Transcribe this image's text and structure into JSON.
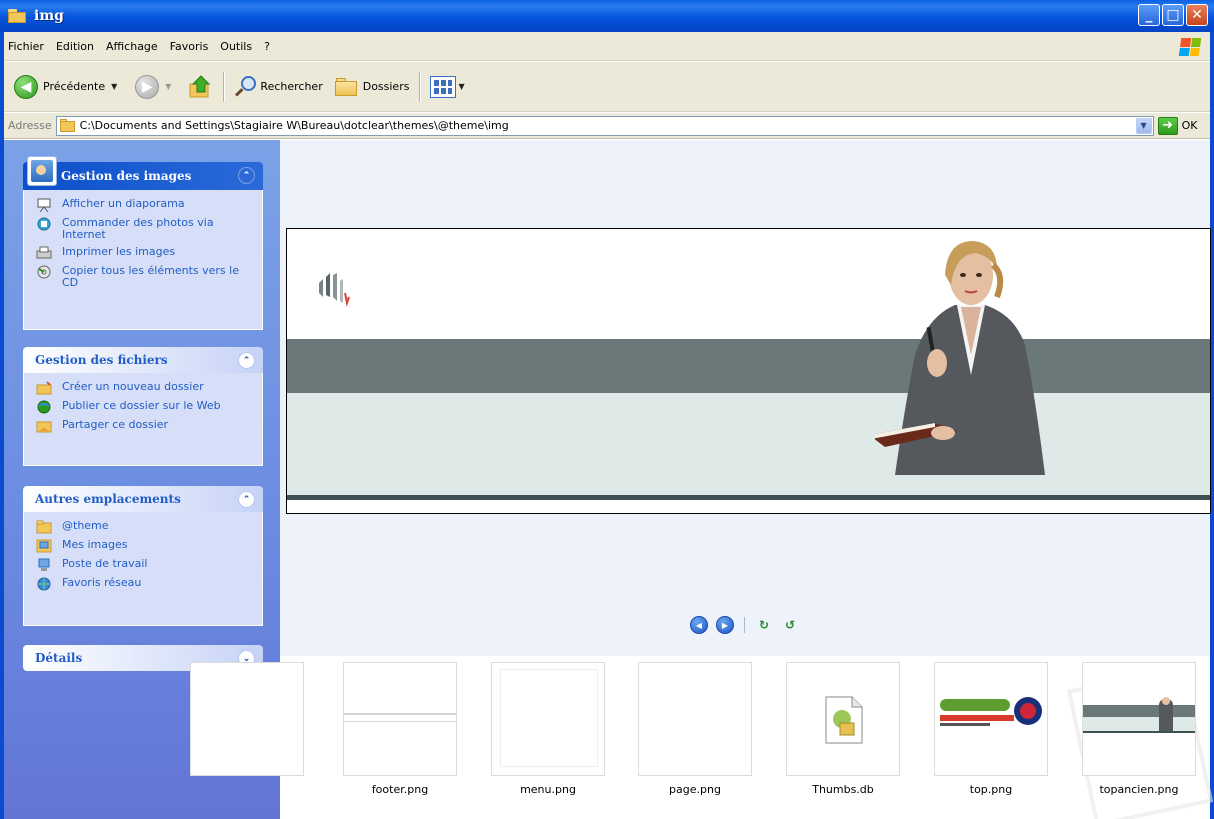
{
  "window": {
    "title": "img",
    "controls": {
      "minimize": "_",
      "maximize": "□",
      "close": "✕"
    }
  },
  "menu": [
    "Fichier",
    "Edition",
    "Affichage",
    "Favoris",
    "Outils",
    "?"
  ],
  "toolbar": {
    "back_label": "Précédente",
    "search_label": "Rechercher",
    "folders_label": "Dossiers"
  },
  "address": {
    "label": "Adresse",
    "path": "C:\\Documents and Settings\\Stagiaire W\\Bureau\\dotclear\\themes\\@theme\\img",
    "go_label": "OK"
  },
  "taskpane": {
    "images": {
      "title": "Gestion des images",
      "links": [
        {
          "label": "Afficher un diaporama",
          "icon": "slideshow-icon"
        },
        {
          "label": "Commander des photos via Internet",
          "icon": "order-photos-icon"
        },
        {
          "label": "Imprimer les images",
          "icon": "print-icon"
        },
        {
          "label": "Copier tous les éléments vers le CD",
          "icon": "cd-icon"
        }
      ]
    },
    "files": {
      "title": "Gestion des fichiers",
      "links": [
        {
          "label": "Créer un nouveau dossier",
          "icon": "new-folder-icon"
        },
        {
          "label": "Publier ce dossier sur le Web",
          "icon": "publish-web-icon"
        },
        {
          "label": "Partager ce dossier",
          "icon": "share-folder-icon"
        }
      ]
    },
    "places": {
      "title": "Autres emplacements",
      "links": [
        {
          "label": "@theme",
          "icon": "folder-icon"
        },
        {
          "label": "Mes images",
          "icon": "my-pictures-icon"
        },
        {
          "label": "Poste de travail",
          "icon": "my-computer-icon"
        },
        {
          "label": "Favoris réseau",
          "icon": "network-icon"
        }
      ]
    },
    "details": {
      "title": "Détails"
    }
  },
  "filmstrip": {
    "items": [
      {
        "label": "footer.png"
      },
      {
        "label": "menu.png"
      },
      {
        "label": "page.png"
      },
      {
        "label": "Thumbs.db"
      },
      {
        "label": "top.png"
      },
      {
        "label": "topancien.png"
      }
    ]
  },
  "colors": {
    "titlebar": "#0553dc",
    "taskpane": "#6a8ae0",
    "link": "#215dc6",
    "banner_dark": "#6a7879",
    "banner_light": "#dfe9e7"
  }
}
